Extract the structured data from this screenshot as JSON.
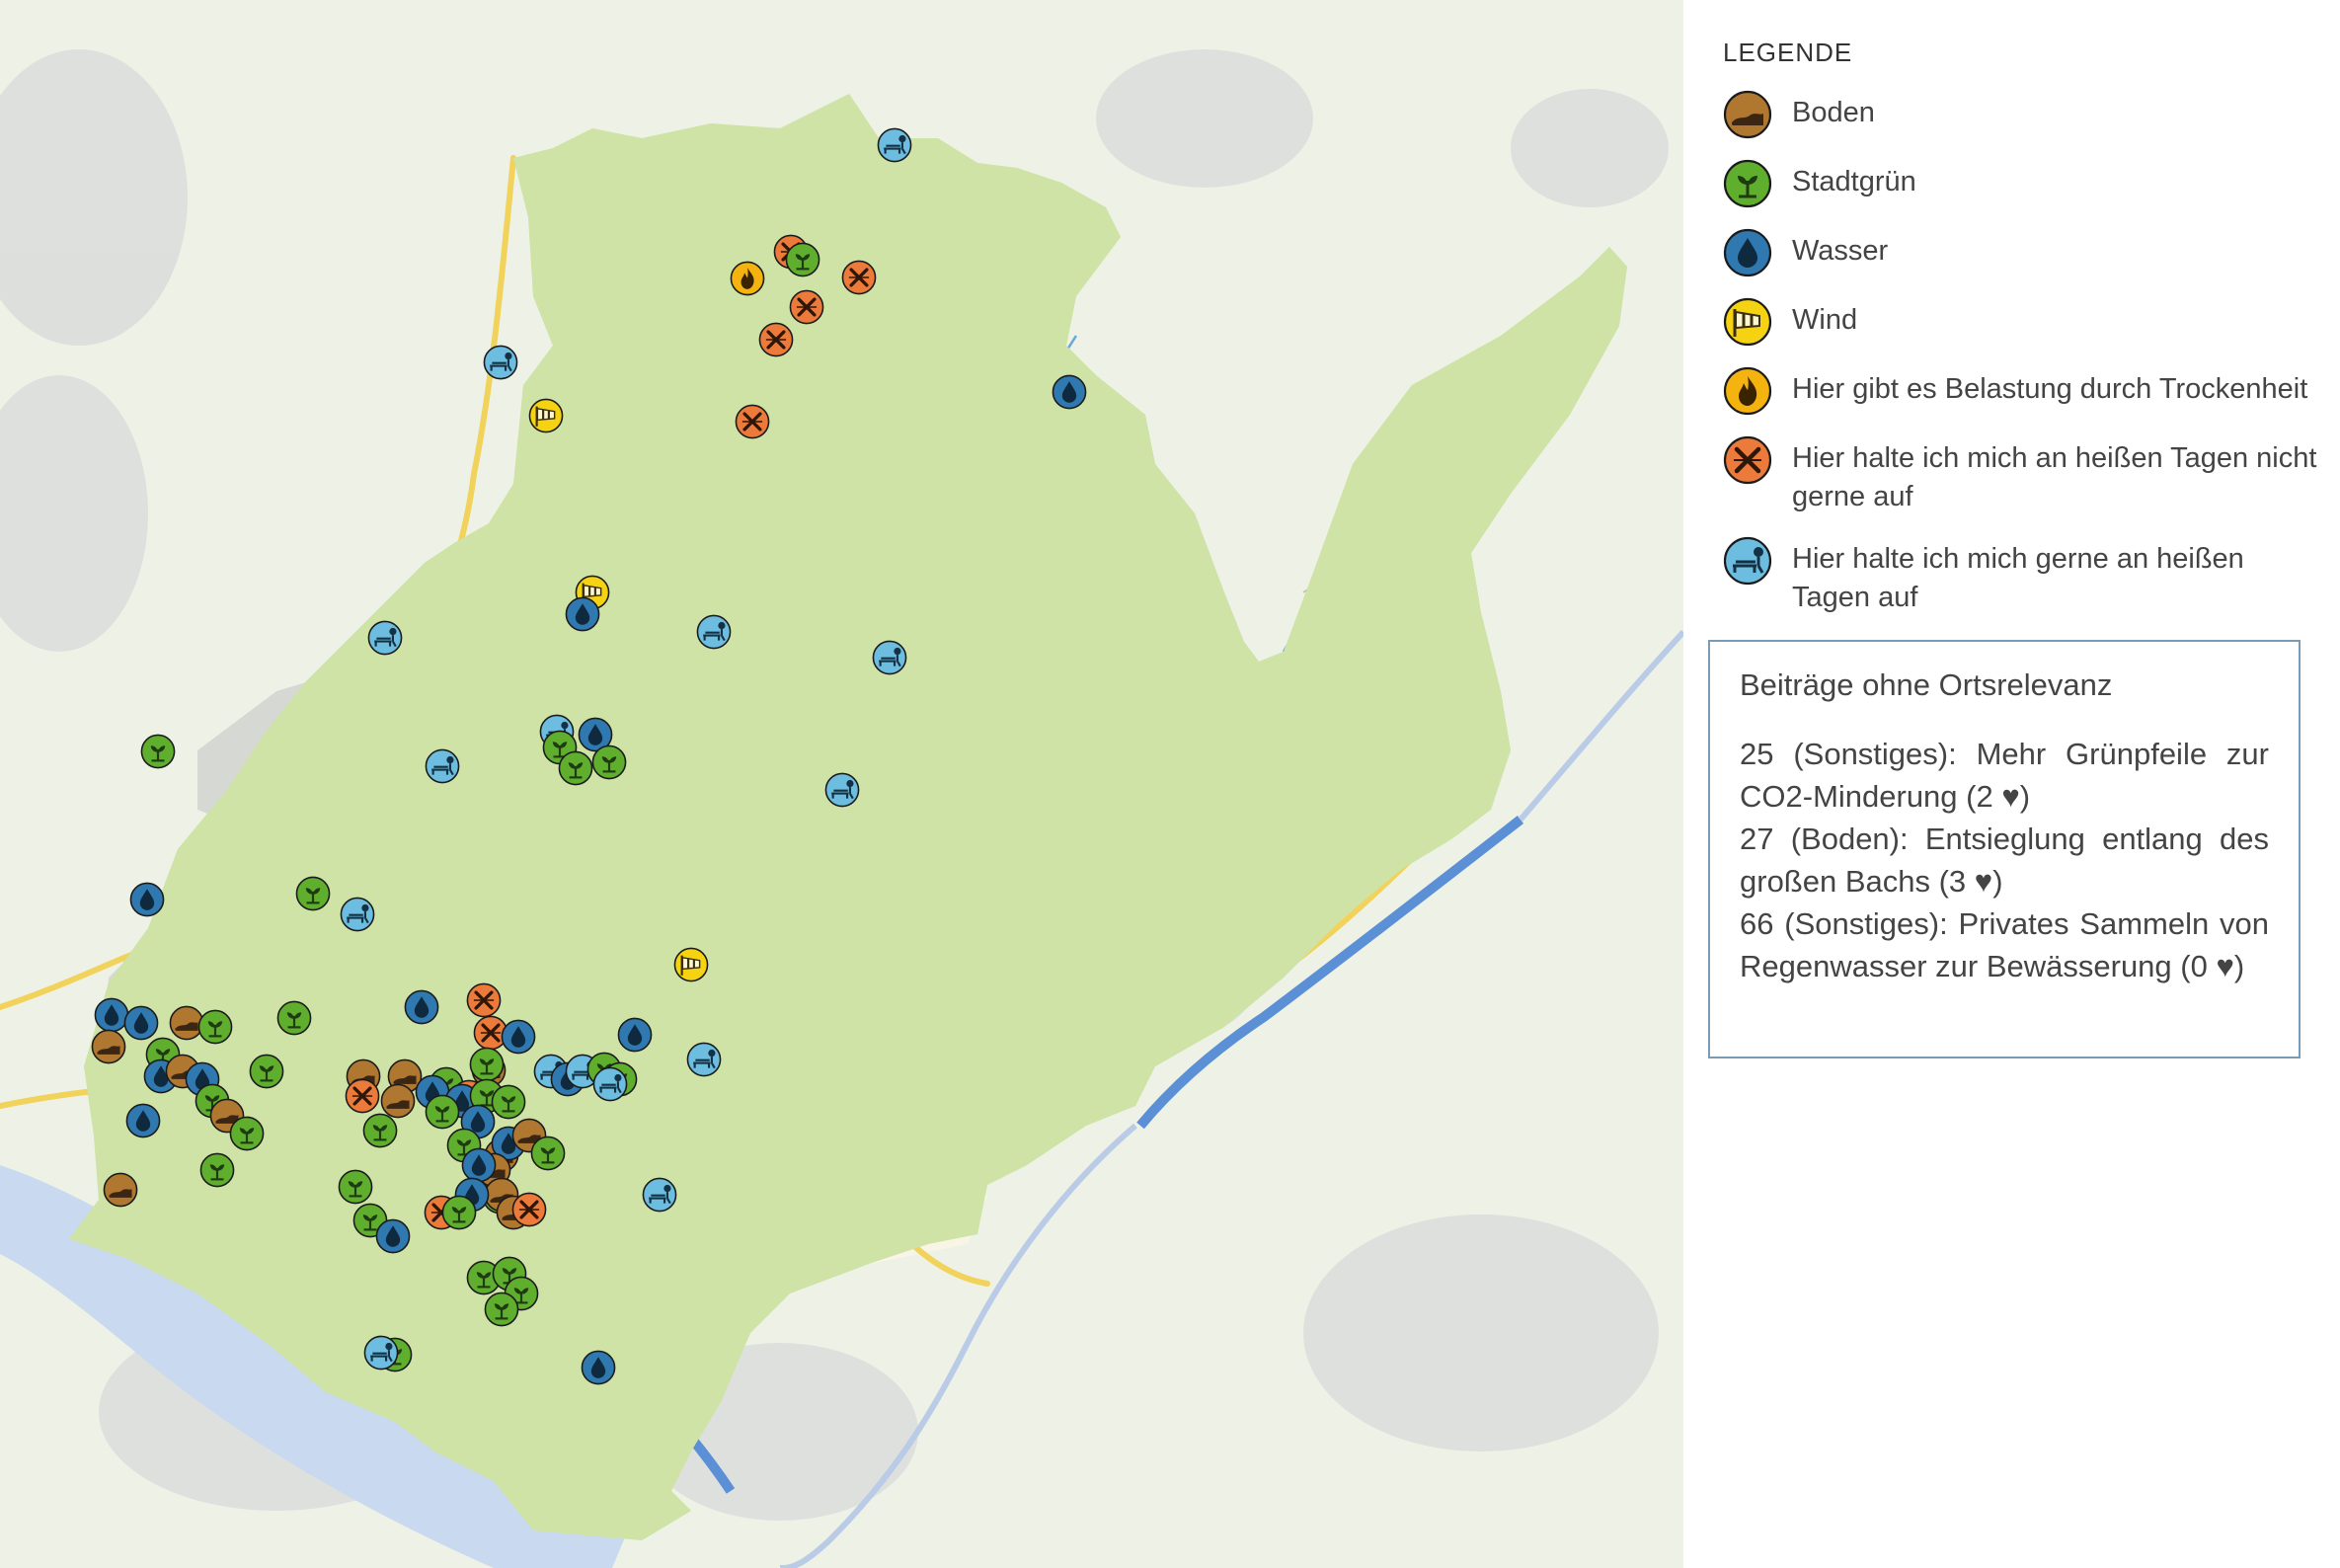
{
  "legend": {
    "title": "LEGENDE",
    "items": [
      {
        "id": "boden",
        "label": "Boden",
        "color": "#b07730",
        "icon": "soil-icon"
      },
      {
        "id": "stadtgruen",
        "label": "Stadtgrün",
        "color": "#5fae2e",
        "icon": "plant-icon"
      },
      {
        "id": "wasser",
        "label": "Wasser",
        "color": "#2f79b0",
        "icon": "water-drop-icon"
      },
      {
        "id": "wind",
        "label": "Wind",
        "color": "#f5d313",
        "icon": "windsock-icon"
      },
      {
        "id": "trocken",
        "label": "Hier gibt es Belastung durch Trockenheit",
        "color": "#f5b30f",
        "icon": "fire-icon"
      },
      {
        "id": "heiss-nicht",
        "label": "Hier halte ich mich an heißen Tagen nicht gerne auf",
        "color": "#ec7a3a",
        "icon": "cross-icon"
      },
      {
        "id": "heiss-gerne",
        "label": "Hier halte ich mich gerne an heißen Tagen auf",
        "color": "#6cbde0",
        "icon": "bench-icon"
      }
    ]
  },
  "other_contributions": {
    "title": "Beiträge ohne Ortsrelevanz",
    "entries": [
      "25 (Sonstiges): Mehr Grünpfeile zur CO2-Minderung (2 ♥)",
      "27 (Boden): Entsieglung entlang des großen Bachs (3 ♥)",
      "66 (Sonstiges): Privates Sammeln von Regenwasser zur Bewässerung (0 ♥)"
    ]
  },
  "map_colors": {
    "background": "#eef2e6",
    "forest": "#c8e0a0",
    "urban": "#d9dcd7",
    "water": "#5b8fd6",
    "road": "#f3d35a",
    "boundary": "#3c2f45"
  }
}
